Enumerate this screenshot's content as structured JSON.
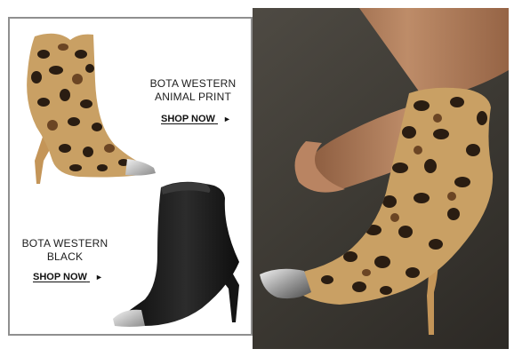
{
  "products": [
    {
      "name_line1": "BOTA WESTERN",
      "name_line2": "ANIMAL PRINT",
      "cta_label": "SHOP NOW",
      "cta_arrow": "►",
      "pattern": "leopard"
    },
    {
      "name_line1": "BOTA WESTERN",
      "name_line2": "BLACK",
      "cta_label": "SHOP NOW",
      "cta_arrow": "►",
      "pattern": "black-leather"
    }
  ],
  "colors": {
    "leopard_base": "#c9a064",
    "leopard_spot": "#2a1d12",
    "leopard_spot_brown": "#6b4524",
    "black_leather": "#151515",
    "metal_toe": "#c4c4c4",
    "photo_background": "#3b3832",
    "skin": "#b98462",
    "panel_border": "#8f8f8f"
  }
}
